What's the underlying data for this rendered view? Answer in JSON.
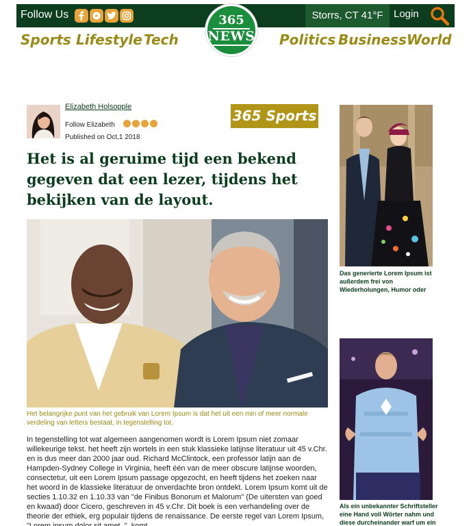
{
  "header": {
    "follow_label": "Follow Us",
    "social_icons": [
      "facebook-icon",
      "youtube-icon",
      "twitter-icon",
      "instagram-icon"
    ],
    "weather": "Storrs, CT 41°F",
    "login_label": "Login",
    "search_icon": "search-icon",
    "colors": {
      "dark_green": "#0b3d1e",
      "medium_green": "#1d5a2e",
      "orange": "#e8a33a",
      "gold": "#9a8a16"
    }
  },
  "logo": {
    "line1": "365",
    "line2": "NEWS"
  },
  "nav": {
    "left": [
      "Sports",
      "Lifestyle",
      "Tech"
    ],
    "right": [
      "Politics",
      "Business",
      "World"
    ]
  },
  "article": {
    "author_name": "Elizabeth Holsopple",
    "follow_author": "Follow Elizabeth",
    "published": "Published on Oct,1 2018",
    "section_badge": "365 Sports",
    "headline": "Het is al geruime tijd een bekend gegeven dat een lezer, tijdens het bekijken van de layout.",
    "caption": "Het belangrijke punt van het gebruik van Lorem Ipsum is dat het uit een min of meer normale verdeling van letters bestaat, in tegenstelling tot.",
    "body": "In tegenstelling tot wat algemeen aangenomen wordt is Lorem Ipsum niet zomaar willekeurige tekst. het heeft zijn wortels in een stuk klassieke latijnse literatuur uit 45 v.Chr. en is dus meer dan 2000 jaar oud. Richard McClintock, een professor latijn aan de Hampden-Sydney College in Virginia, heeft één van de meer obscure latijnse woorden, consectetur, uit een Lorem Ipsum passage opgezocht, en heeft tijdens het zoeken naar het woord in de klassieke literatuur de onverdachte bron ontdekt. Lorem Ipsum komt uit de secties 1.10.32 en 1.10.33 van \"de Finibus Bonorum et Malorum\" (De uitersten van goed en kwaad) door Cicero, geschreven in 45 v.Chr. Dit boek is een verhandeling over de theorie der ethiek, erg populair tijdens de renaissance. De eerste regel van Lorem Ipsum, \"Lorem ipsum dolor sit amet..\", komt"
  },
  "sidebar": {
    "items": [
      {
        "caption": "Das generierte Lorem Ipsum ist außerdem frei von Wiederholungen, Humor oder"
      },
      {
        "caption": "Als ein unbekannter Schriftsteller eine Hand voll Wörter nahm und diese durcheinander warf um ein"
      }
    ]
  }
}
